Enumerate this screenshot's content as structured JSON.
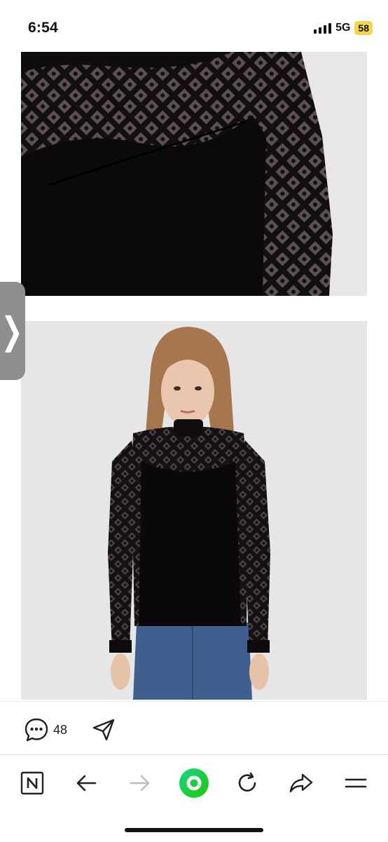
{
  "status_bar": {
    "time": "6:54",
    "network": "5G",
    "battery": "58",
    "battery_color": "#f7d54a"
  },
  "post": {
    "images": [
      {
        "name": "top-lace-closeup-photo"
      },
      {
        "name": "model-wearing-lace-top-photo"
      }
    ],
    "comment_count": "48"
  },
  "toolbar": {
    "items": [
      "naver-home-icon",
      "back-arrow-icon",
      "forward-arrow-icon",
      "green-circle-icon",
      "reload-icon",
      "share-arrow-icon",
      "menu-icon"
    ],
    "accent": "#1ec800"
  }
}
